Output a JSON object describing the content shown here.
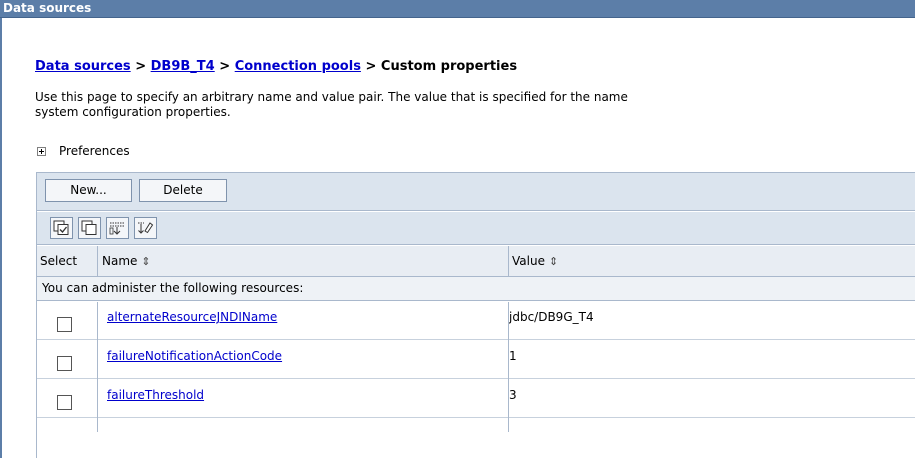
{
  "window": {
    "title": "Data sources"
  },
  "breadcrumb": {
    "items": [
      "Data sources",
      "DB9B_T4",
      "Connection pools",
      "Custom properties"
    ],
    "separator": ">"
  },
  "description": {
    "line1": "Use this page to specify an arbitrary name and value pair. The value that is specified for the name",
    "line2": "system configuration properties."
  },
  "preferences": {
    "label": "Preferences",
    "expand_icon": "plus-expand-icon"
  },
  "toolbar": {
    "new_label": "New...",
    "delete_label": "Delete"
  },
  "icon_toolbar": [
    {
      "name": "select-all-icon"
    },
    {
      "name": "deselect-all-icon"
    },
    {
      "name": "show-filter-icon"
    },
    {
      "name": "clear-filter-icon"
    }
  ],
  "table": {
    "columns": {
      "select": "Select",
      "name": "Name",
      "value": "Value",
      "sort_glyph": "⇕"
    },
    "group_label": "You can administer the following resources:",
    "rows": [
      {
        "name": "alternateResourceJNDIName",
        "value": "jdbc/DB9G_T4"
      },
      {
        "name": "failureNotificationActionCode",
        "value": "1"
      },
      {
        "name": "failureThreshold",
        "value": "3"
      }
    ]
  },
  "colors": {
    "titlebar": "#5c7ea8",
    "link": "#0000cc",
    "toolbar_bg": "#dbe4ee",
    "border": "#a9b8cc"
  }
}
